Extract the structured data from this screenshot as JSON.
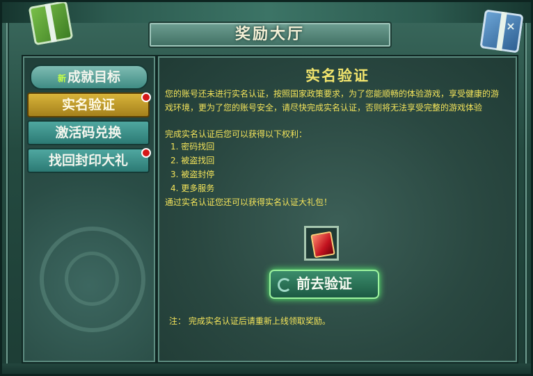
{
  "window": {
    "title": "奖励大厅",
    "close_glyph": "×"
  },
  "sidebar": {
    "items": [
      {
        "new_tag": "新",
        "label": "成就目标"
      },
      {
        "label": "实名验证"
      },
      {
        "label": "激活码兑换"
      },
      {
        "label": "找回封印大礼"
      }
    ]
  },
  "main": {
    "title": "实名验证",
    "intro": "您的账号还未进行实名认证，按照国家政策要求，为了您能顺畅的体验游戏，享受健康的游戏环境，更为了您的账号安全，请尽快完成实名认证，否则将无法享受完整的游戏体验",
    "benefits_header": "完成实名认证后您可以获得以下权利：",
    "benefits": [
      "1. 密码找回",
      "2. 被盗找回",
      "3. 被盗封停",
      "4. 更多服务"
    ],
    "gift_line": "通过实名认证您还可以获得实名认证大礼包！",
    "button_label": "前去验证",
    "note": "注：  完成实名认证后请重新上线领取奖励。"
  },
  "colors": {
    "accent_text": "#f4e45a",
    "active_tab": "#d8b43a",
    "tab": "#4fa7a0"
  }
}
